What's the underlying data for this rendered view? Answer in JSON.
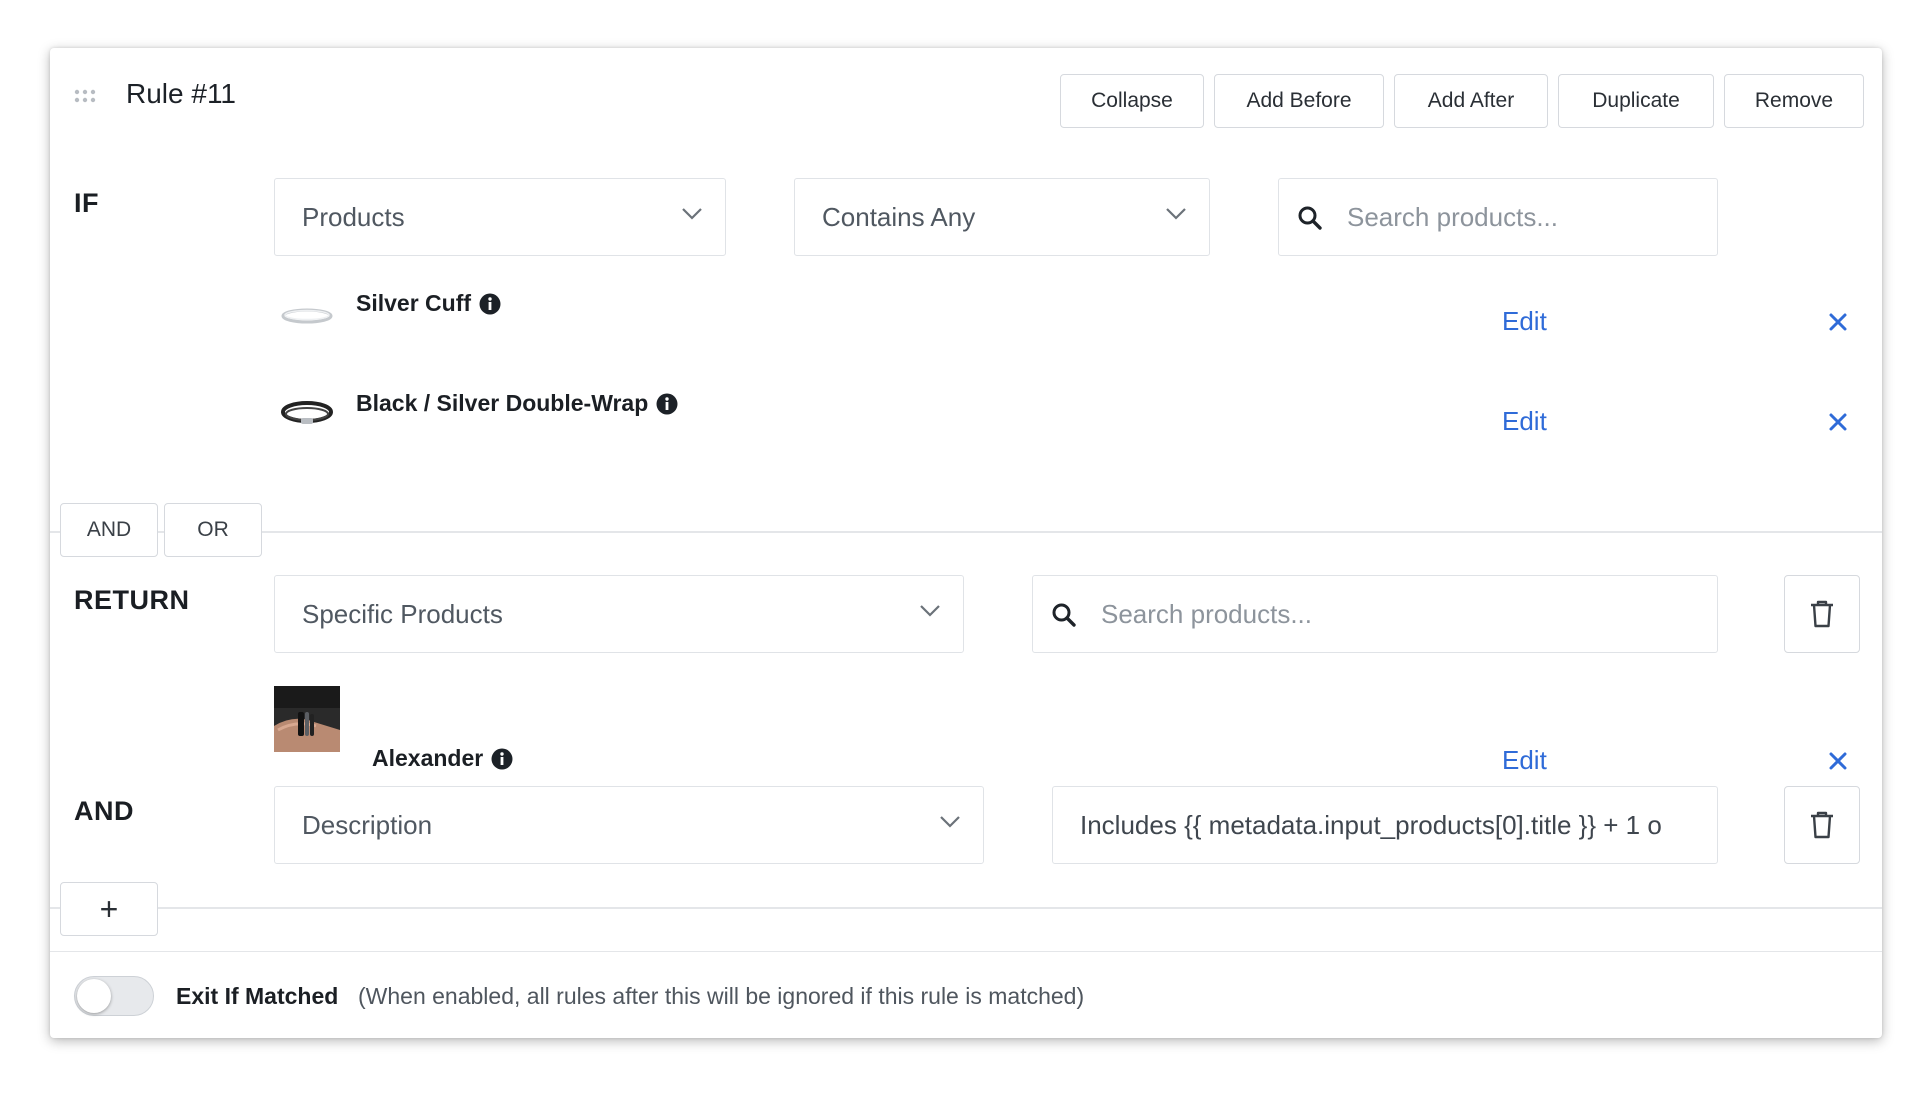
{
  "rule": {
    "title": "Rule #11"
  },
  "toolbar": {
    "collapse": "Collapse",
    "add_before": "Add Before",
    "add_after": "Add After",
    "duplicate": "Duplicate",
    "remove": "Remove"
  },
  "if_section": {
    "label": "IF",
    "field_select": "Products",
    "operator_select": "Contains Any",
    "search_placeholder": "Search products...",
    "products": [
      {
        "name": "Silver Cuff",
        "edit": "Edit"
      },
      {
        "name": "Black / Silver Double-Wrap",
        "edit": "Edit"
      }
    ]
  },
  "logic": {
    "and": "AND",
    "or": "OR"
  },
  "return_section": {
    "label": "RETURN",
    "type_select": "Specific Products",
    "search_placeholder": "Search products...",
    "products": [
      {
        "name": "Alexander",
        "edit": "Edit"
      }
    ]
  },
  "and_section": {
    "label": "AND",
    "field_select": "Description",
    "value": "Includes {{ metadata.input_products[0].title }} + 1 o"
  },
  "add_condition": "+",
  "exit_if_matched": {
    "label": "Exit If Matched",
    "help": "(When enabled, all rules after this will be ignored if this rule is matched)",
    "enabled": false
  },
  "colors": {
    "link": "#2f6bd8",
    "border": "#e0e3e7"
  }
}
